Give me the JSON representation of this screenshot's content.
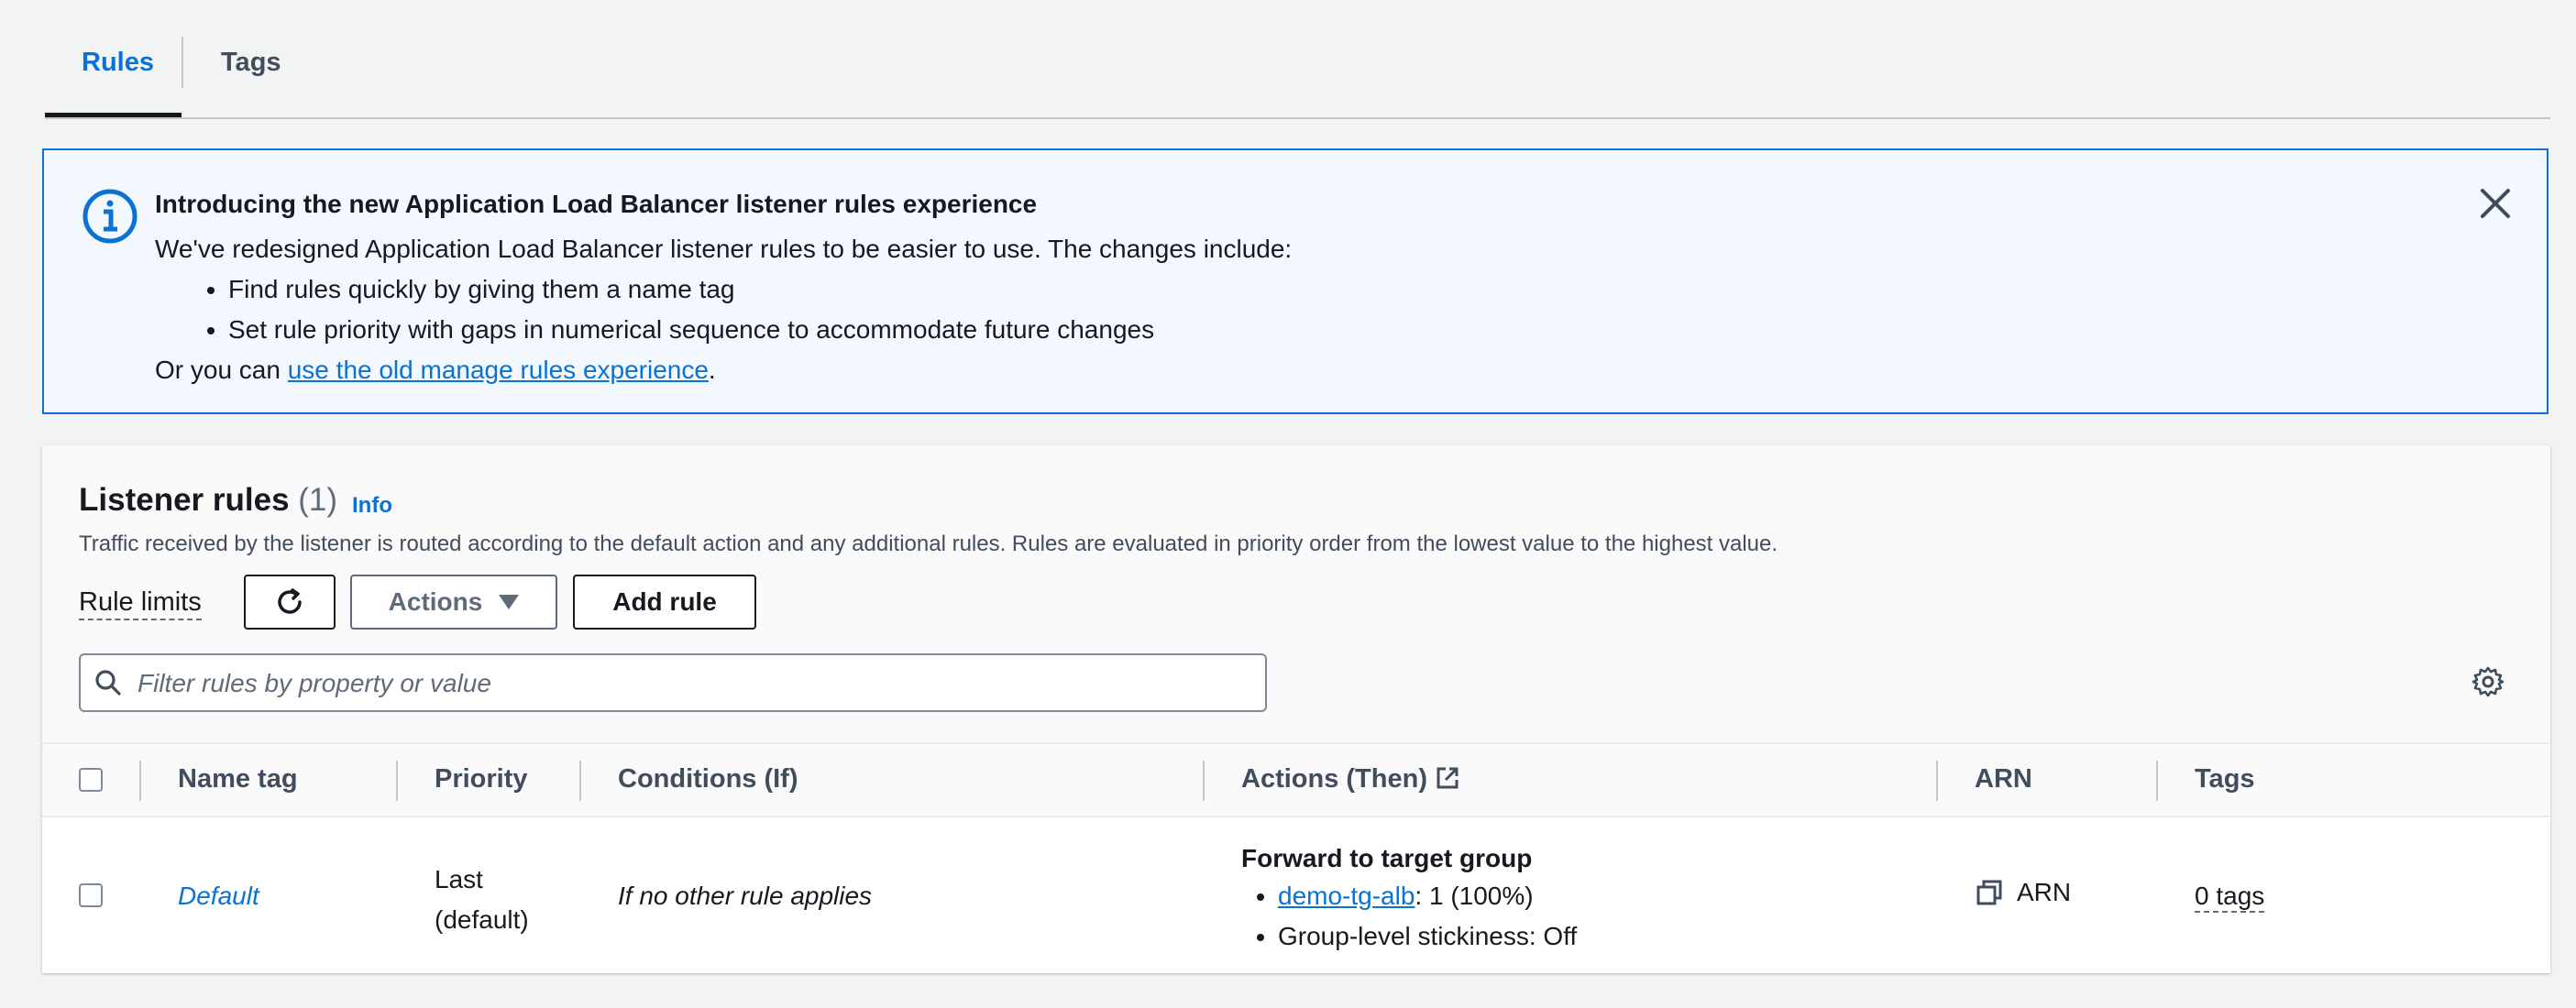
{
  "tabs": [
    {
      "label": "Rules",
      "active": true
    },
    {
      "label": "Tags",
      "active": false
    }
  ],
  "alert": {
    "title": "Introducing the new Application Load Balancer listener rules experience",
    "intro": "We've redesigned Application Load Balancer listener rules to be easier to use. The changes include:",
    "bullets": [
      "Find rules quickly by giving them a name tag",
      "Set rule priority with gaps in numerical sequence to accommodate future changes"
    ],
    "footer_prefix": "Or you can ",
    "footer_link": "use the old manage rules experience",
    "footer_suffix": ".",
    "icon": "info-icon",
    "close_icon": "close-icon"
  },
  "listener_rules": {
    "title": "Listener rules",
    "count": "(1)",
    "info_link": "Info",
    "description": "Traffic received by the listener is routed according to the default action and any additional rules. Rules are evaluated in priority order from the lowest value to the highest value.",
    "rule_limits": "Rule limits",
    "refresh_icon": "refresh-icon",
    "actions_label": "Actions",
    "add_rule_label": "Add rule",
    "filter_placeholder": "Filter rules by property or value",
    "settings_icon": "gear-icon"
  },
  "table": {
    "columns": [
      "Name tag",
      "Priority",
      "Conditions (If)",
      "Actions (Then)",
      "ARN",
      "Tags"
    ],
    "rows": [
      {
        "name": "Default",
        "priority_line1": "Last",
        "priority_line2": "(default)",
        "condition": "If no other rule applies",
        "action_title": "Forward to target group",
        "action_target_link": "demo-tg-alb",
        "action_target_rest": ": 1 (100%)",
        "action_stickiness": "Group-level stickiness: Off",
        "arn_label": "ARN",
        "tags": "0 tags"
      }
    ]
  },
  "colors": {
    "accent": "#0972d3",
    "alert_bg": "#f2f8fd",
    "text": "#16191f",
    "muted": "#5f6b7a"
  }
}
